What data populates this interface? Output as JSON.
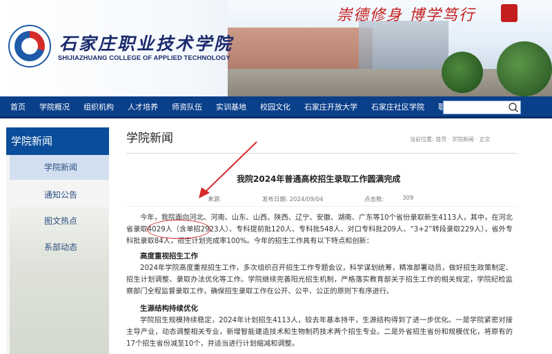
{
  "header": {
    "school_name_cn": "石家庄职业技术学院",
    "school_name_en": "SHIJIAZHUANG COLLEGE OF APPLIED TECHNOLOGY",
    "motto": "崇德修身 博学笃行"
  },
  "nav": {
    "items": [
      "首页",
      "学院概况",
      "组织机构",
      "人才培养",
      "师资队伍",
      "实训基地",
      "校园文化",
      "石家庄开放大学",
      "石家庄社区学院",
      "职教集团"
    ],
    "search_placeholder": ""
  },
  "sidebar": {
    "title": "学院新闻",
    "items": [
      {
        "label": "学院新闻",
        "active": true
      },
      {
        "label": "通知公告",
        "active": false
      },
      {
        "label": "图文热点",
        "active": false
      },
      {
        "label": "系部动态",
        "active": false
      }
    ]
  },
  "main": {
    "section_title": "学院新闻",
    "breadcrumb": "当前位置: 首页 · 学院新闻 · 正文",
    "article": {
      "title": "我院2024年普通高校招生录取工作圆满完成",
      "source_label": "来源:",
      "date_label": "发布日期: 2024/09/04",
      "views_label": "点击数:",
      "views": "309",
      "intro": "今年，我院面向河北、河南、山东、山西、陕西、辽宁、安徽、湖南、广东等10个省份录取新生4113人，其中，在河北省录取4029人（含单招2923人）、专科提前批120人、专科批548人、对口专科批209人、“3+2”转段录取229人），省外专科批录取84人，招生计划完成率100%。今年的招生工作具有以下特点和创新：",
      "h1": "高度重视招生工作",
      "p1": "2024年学院高度重视招生工作，多次组织召开招生工作专题会议，科学谋划统筹，精准部署动员，做好招生政策制定、招生计划调整、录取办法优化等工作。学院继续完善阳光招生机制，严格落实教育部关于招生工作的相关规定，学院纪检监察部门全程监督录取工作，确保招生录取工作在公开、公平、公正的原则下有序进行。",
      "h2": "生源结构持续优化",
      "p2": "学院招生规模持续稳定，2024年计划招生4113人，较去年基本持平，生源结构得到了进一步优化。一是学院紧密对接主导产业，动态调整相关专业，新增智能建造技术和生物制药技术两个招生专业。二是外省招生省份和规模优化，将原有的17个招生省份减至10个，并适当进行计划缩减和调整。"
    }
  },
  "colors": {
    "nav_bg": "#0a3f8a",
    "sidebar_title_bg": "#0a4d9a",
    "annotation": "#d62a2a"
  }
}
